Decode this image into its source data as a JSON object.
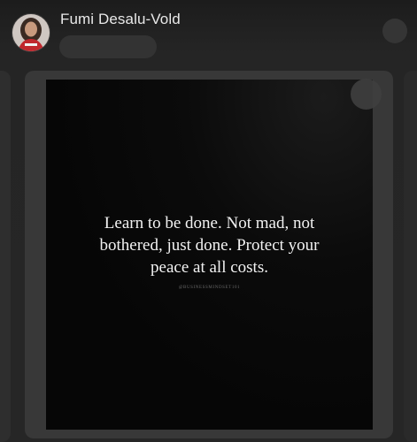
{
  "post": {
    "author_name": "Fumi Desalu-Vold",
    "quote_lines": [
      "Learn to be done. Not mad, not",
      "bothered, just done. Protect your",
      "peace at all costs."
    ],
    "watermark": "@BUSINESSMINDSET101"
  },
  "colors": {
    "background": "#222222",
    "card": "#383838",
    "image_background": "#080808",
    "text": "#e8e8e8"
  }
}
